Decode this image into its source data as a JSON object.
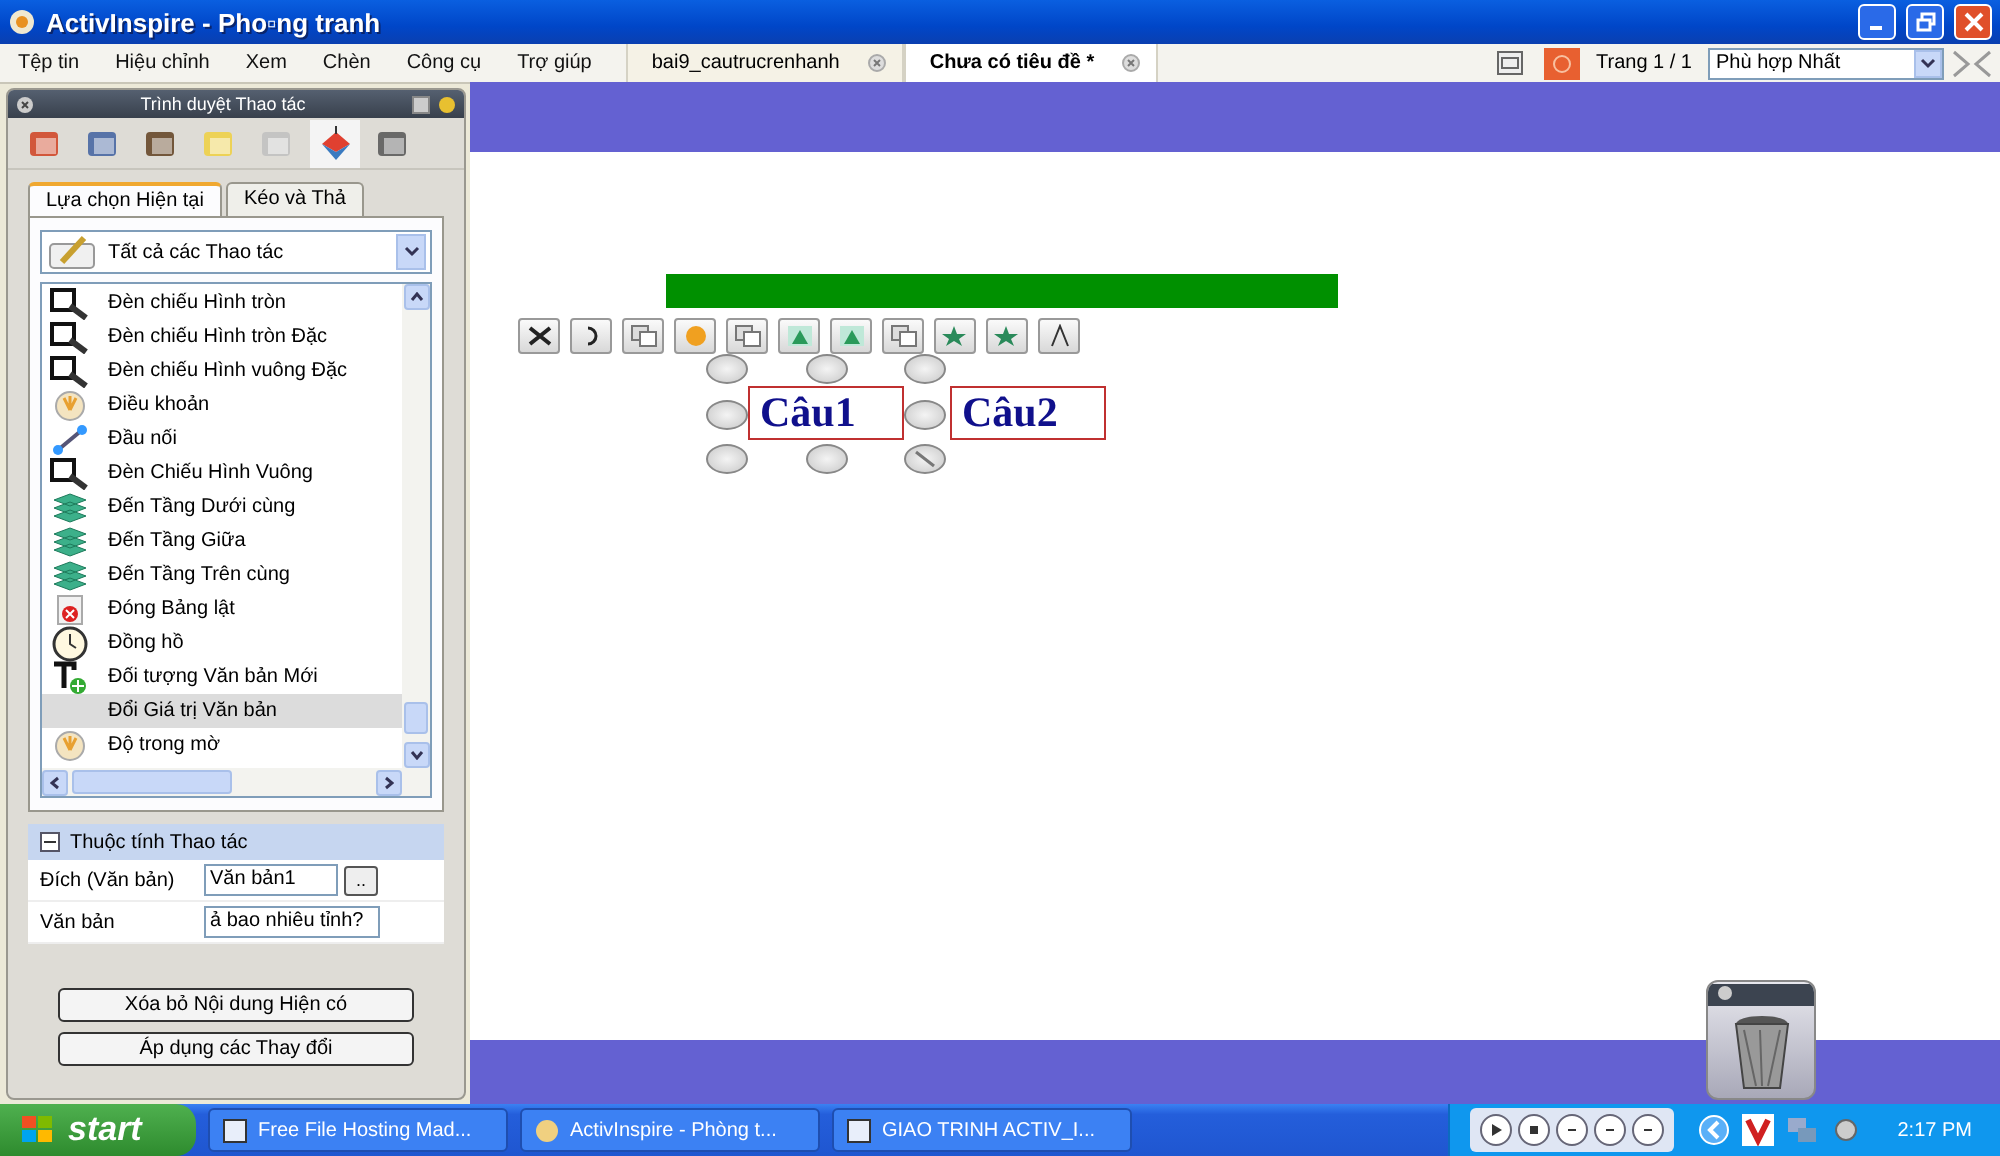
{
  "window": {
    "title": "ActivInspire - Pho▫ng tranh"
  },
  "menu": [
    "Tệp tin",
    "Hiệu chỉnh",
    "Xem",
    "Chèn",
    "Công cụ",
    "Trợ giúp"
  ],
  "doc_tabs": [
    {
      "label": "bai9_cautrucrenhanh",
      "selected": false
    },
    {
      "label": "Chưa có tiêu đề *",
      "selected": true
    }
  ],
  "page_indicator": "Trang 1 / 1",
  "zoom": {
    "value": "Phù hợp Nhất"
  },
  "browser": {
    "title": "Trình duyệt Thao tác",
    "tabs": [
      {
        "label": "Lựa chọn Hiện tại",
        "selected": true
      },
      {
        "label": "Kéo và Thả",
        "selected": false
      }
    ],
    "filter": {
      "value": "Tất cả các Thao tác"
    },
    "actions": [
      {
        "label": "Đèn chiếu Hình tròn",
        "kind": "spotlight",
        "selected": false
      },
      {
        "label": "Đèn chiếu Hình tròn Đặc",
        "kind": "spotlight",
        "selected": false
      },
      {
        "label": "Đèn chiếu Hình vuông Đặc",
        "kind": "spotlight",
        "selected": false
      },
      {
        "label": "Điều khoản",
        "kind": "clause",
        "selected": false
      },
      {
        "label": "Đầu nối",
        "kind": "connector",
        "selected": false
      },
      {
        "label": "Đèn Chiếu Hình Vuông",
        "kind": "spotlight",
        "selected": false
      },
      {
        "label": "Đến Tầng Dưới cùng",
        "kind": "layer",
        "selected": false
      },
      {
        "label": "Đến Tầng Giữa",
        "kind": "layer",
        "selected": false
      },
      {
        "label": "Đến Tầng Trên cùng",
        "kind": "layer",
        "selected": false
      },
      {
        "label": "Đóng Bảng lật",
        "kind": "close",
        "selected": false
      },
      {
        "label": "Đồng hồ",
        "kind": "clock",
        "selected": false
      },
      {
        "label": "Đối tượng Văn bản Mới",
        "kind": "text",
        "selected": false
      },
      {
        "label": "Đổi Giá trị Văn bản",
        "kind": "none",
        "selected": true
      },
      {
        "label": "Độ trong mờ",
        "kind": "clause",
        "selected": false
      }
    ],
    "properties": {
      "title": "Thuộc tính Thao tác",
      "expanded": true,
      "rows": [
        {
          "label": "Đích (Văn bản)",
          "value": "Văn bản1",
          "browse": ".."
        },
        {
          "label": "Văn bản",
          "value": "ả bao nhiêu tỉnh?"
        }
      ]
    },
    "buttons": [
      "Xóa bỏ Nội dung Hiện có",
      "Áp dụng các Thay đổi"
    ]
  },
  "canvas": {
    "textboxes": [
      {
        "text": "Câu1",
        "selected": true
      },
      {
        "text": "Câu2",
        "selected": false
      }
    ]
  },
  "taskbar": {
    "start": "start",
    "items": [
      "Free File Hosting Mad...",
      "ActivInspire - Phòng t...",
      "GIAO TRINH ACTIV_I..."
    ],
    "clock": "2:17 PM"
  }
}
